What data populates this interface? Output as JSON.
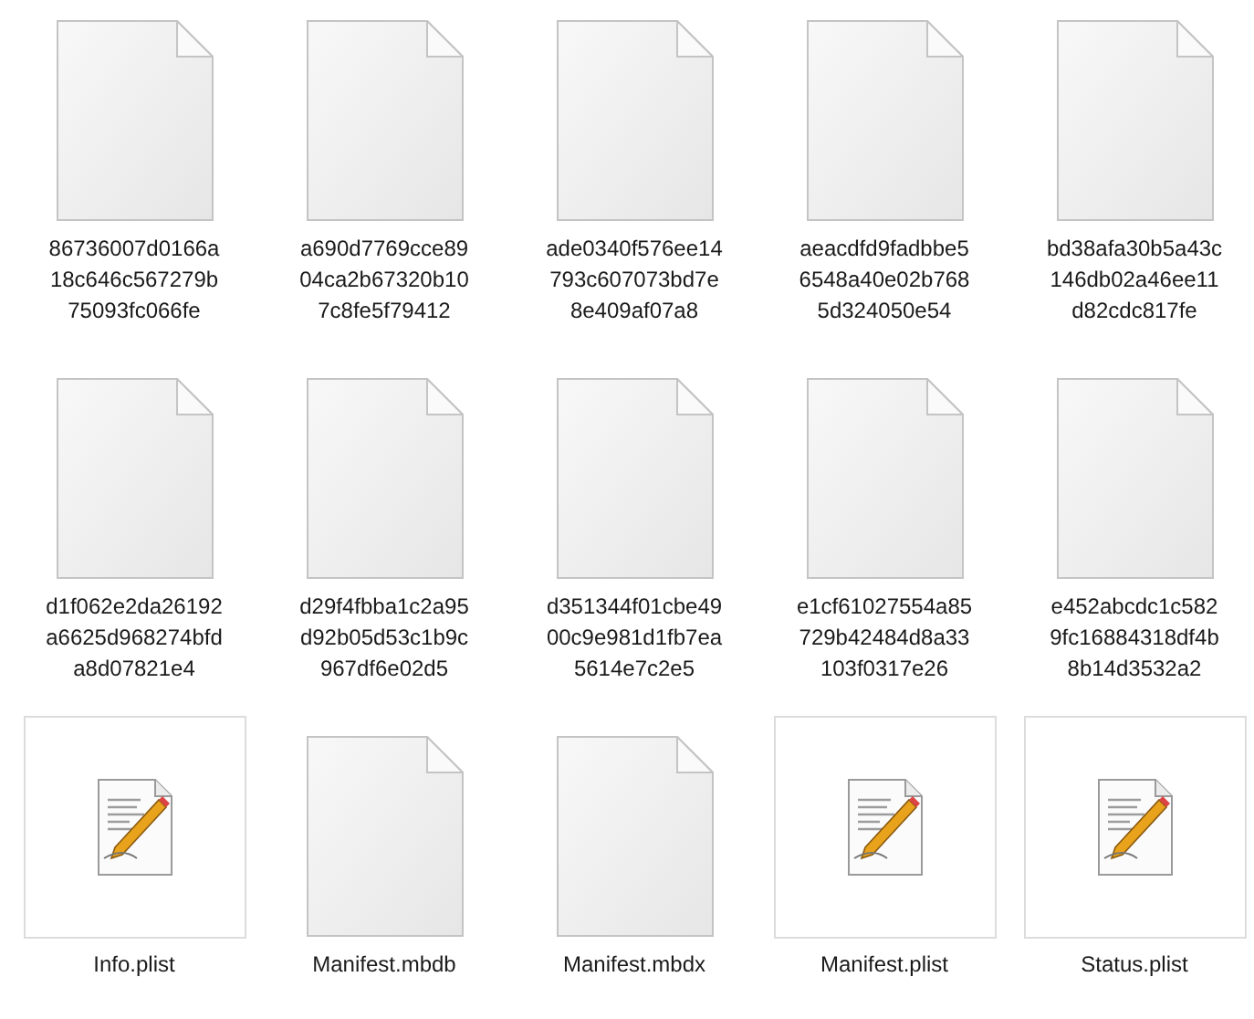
{
  "files": [
    {
      "name": "86736007d0166a18c646c567279b75093fc066fe",
      "kind": "blank"
    },
    {
      "name": "a690d7769cce8904ca2b67320b107c8fe5f79412",
      "kind": "blank"
    },
    {
      "name": "ade0340f576ee14793c607073bd7e8e409af07a8",
      "kind": "blank"
    },
    {
      "name": "aeacdfd9fadbbe56548a40e02b7685d324050e54",
      "kind": "blank"
    },
    {
      "name": "bd38afa30b5a43c146db02a46ee11d82cdc817fe",
      "kind": "blank"
    },
    {
      "name": "d1f062e2da26192a6625d968274bfda8d07821e4",
      "kind": "blank"
    },
    {
      "name": "d29f4fbba1c2a95d92b05d53c1b9c967df6e02d5",
      "kind": "blank"
    },
    {
      "name": "d351344f01cbe4900c9e981d1fb7ea5614e7c2e5",
      "kind": "blank"
    },
    {
      "name": "e1cf61027554a85729b42484d8a33103f0317e26",
      "kind": "blank"
    },
    {
      "name": "e452abcdc1c5829fc16884318df4b8b14d3532a2",
      "kind": "blank"
    },
    {
      "name": "Info.plist",
      "kind": "plist"
    },
    {
      "name": "Manifest.mbdb",
      "kind": "blank"
    },
    {
      "name": "Manifest.mbdx",
      "kind": "blank"
    },
    {
      "name": "Manifest.plist",
      "kind": "plist"
    },
    {
      "name": "Status.plist",
      "kind": "plist"
    }
  ]
}
